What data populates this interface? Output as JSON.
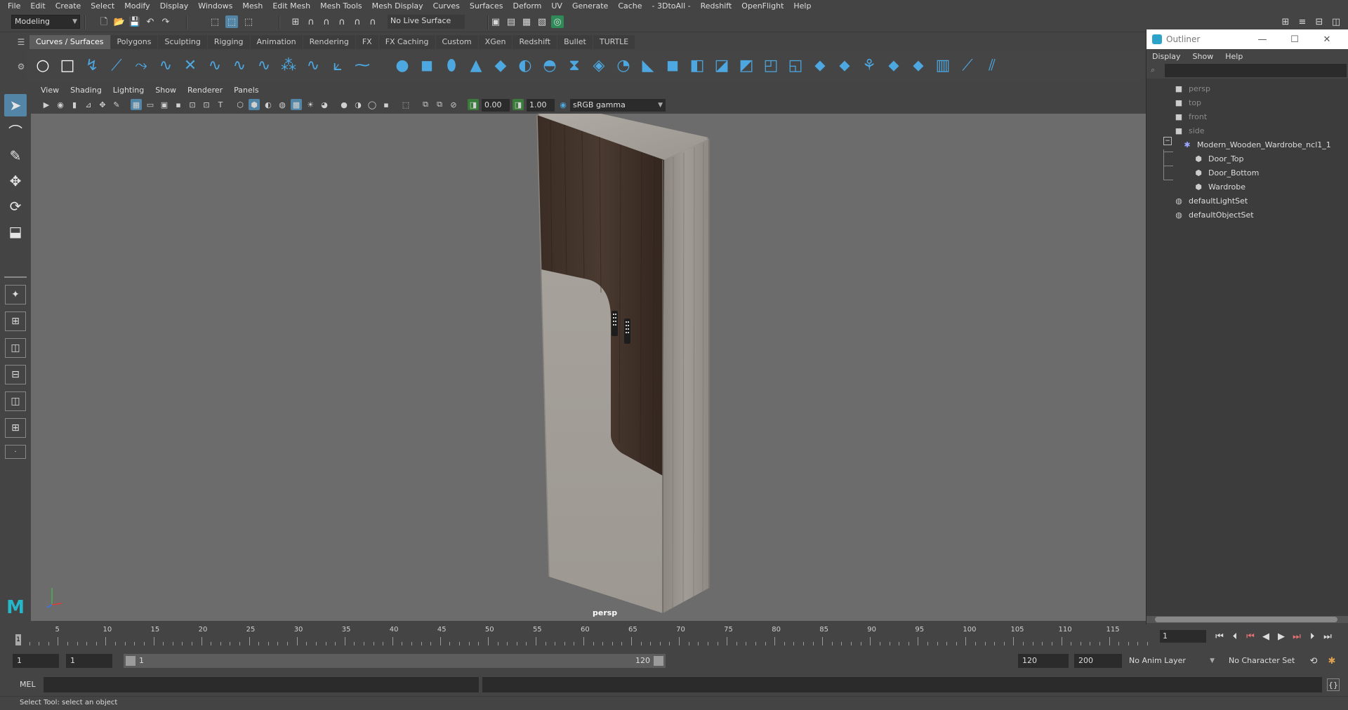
{
  "menubar": [
    "File",
    "Edit",
    "Create",
    "Select",
    "Modify",
    "Display",
    "Windows",
    "Mesh",
    "Edit Mesh",
    "Mesh Tools",
    "Mesh Display",
    "Curves",
    "Surfaces",
    "Deform",
    "UV",
    "Generate",
    "Cache",
    "- 3DtoAll -",
    "Redshift",
    "OpenFlight",
    "Help"
  ],
  "statusline": {
    "menuset": "Modeling",
    "live_surface": "No Live Surface"
  },
  "shelf_tabs": [
    "Curves / Surfaces",
    "Polygons",
    "Sculpting",
    "Rigging",
    "Animation",
    "Rendering",
    "FX",
    "FX Caching",
    "Custom",
    "XGen",
    "Redshift",
    "Bullet",
    "TURTLE"
  ],
  "shelf_active": "Curves / Surfaces",
  "panel_menu": [
    "View",
    "Shading",
    "Lighting",
    "Show",
    "Renderer",
    "Panels"
  ],
  "panel_tools": {
    "exposure": "0.00",
    "gamma": "1.00",
    "color_space": "sRGB gamma"
  },
  "viewport": {
    "camera": "persp"
  },
  "outliner": {
    "title": "Outliner",
    "menu": [
      "Display",
      "Show",
      "Help"
    ],
    "items": [
      {
        "label": "persp",
        "icon": "camera-icon",
        "dim": true
      },
      {
        "label": "top",
        "icon": "camera-icon",
        "dim": true
      },
      {
        "label": "front",
        "icon": "camera-icon",
        "dim": true
      },
      {
        "label": "side",
        "icon": "camera-icon",
        "dim": true
      },
      {
        "label": "Modern_Wooden_Wardrobe_ncl1_1",
        "icon": "group-icon",
        "dim": false
      },
      {
        "label": "Door_Top",
        "icon": "mesh-icon",
        "dim": false
      },
      {
        "label": "Door_Bottom",
        "icon": "mesh-icon",
        "dim": false
      },
      {
        "label": "Wardrobe",
        "icon": "mesh-icon",
        "dim": false
      },
      {
        "label": "defaultLightSet",
        "icon": "set-icon",
        "dim": false
      },
      {
        "label": "defaultObjectSet",
        "icon": "set-icon",
        "dim": false
      }
    ]
  },
  "timeline": {
    "labels": [
      "1",
      "5",
      "10",
      "15",
      "20",
      "25",
      "30",
      "35",
      "40",
      "45",
      "50",
      "55",
      "60",
      "65",
      "70",
      "75",
      "80",
      "85",
      "90",
      "95",
      "100",
      "105",
      "110",
      "115"
    ],
    "current_frame_field": "1",
    "current_frame": "1"
  },
  "range": {
    "start": "1",
    "range_start": "1",
    "bar_start": "1",
    "bar_end": "120",
    "range_end": "120",
    "end": "200",
    "anim_layer": "No Anim Layer",
    "character_set": "No Character Set"
  },
  "cmdline": {
    "lang": "MEL"
  },
  "help_line": "Select Tool: select an object",
  "colors": {
    "accent": "#5285a6",
    "shelf_icon": "#4da7e0",
    "viewport_bg": "#6c6c6c"
  }
}
